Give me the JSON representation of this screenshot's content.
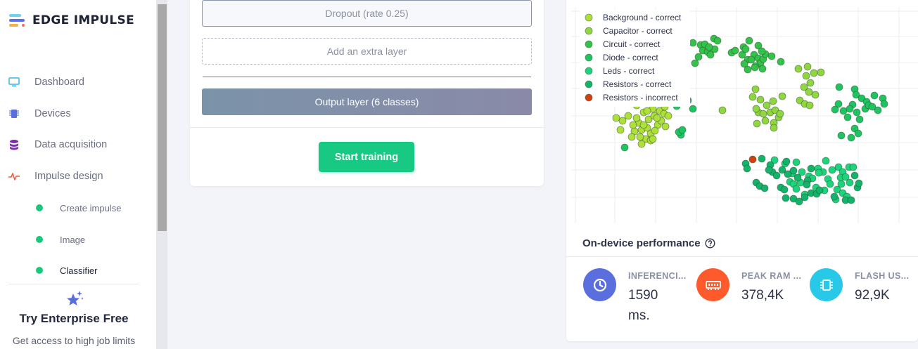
{
  "app": {
    "brand": "EDGE IMPULSE"
  },
  "sidebar": {
    "items": [
      {
        "label": "Dashboard",
        "icon": "monitor-icon"
      },
      {
        "label": "Devices",
        "icon": "chip-icon"
      },
      {
        "label": "Data acquisition",
        "icon": "database-icon"
      },
      {
        "label": "Impulse design",
        "icon": "pulse-icon"
      }
    ],
    "subitems": [
      {
        "label": "Create impulse"
      },
      {
        "label": "Image"
      },
      {
        "label": "Classifier",
        "active": true
      }
    ],
    "enterprise": {
      "title": "Try Enterprise Free",
      "subtitle": "Get access to high job limits"
    }
  },
  "layers": {
    "dropout": "Dropout (rate 0.25)",
    "add_extra": "Add an extra layer",
    "output": "Output layer (6 classes)"
  },
  "training": {
    "start_label": "Start training"
  },
  "chart_data": {
    "type": "scatter",
    "legend_position": "top-left",
    "grid": true,
    "series": [
      {
        "name": "Background - correct",
        "color": "#aee03a",
        "points": [
          [
            915,
            160
          ],
          [
            922,
            170
          ],
          [
            930,
            165
          ],
          [
            908,
            175
          ],
          [
            935,
            178
          ],
          [
            912,
            185
          ],
          [
            925,
            190
          ],
          [
            940,
            172
          ],
          [
            918,
            198
          ],
          [
            905,
            168
          ],
          [
            928,
            155
          ],
          [
            938,
            158
          ],
          [
            944,
            162
          ],
          [
            902,
            187
          ],
          [
            920,
            182
          ],
          [
            931,
            186
          ],
          [
            946,
            180
          ],
          [
            910,
            195
          ],
          [
            925,
            200
          ],
          [
            915,
            178
          ],
          [
            934,
            168
          ],
          [
            900,
            178
          ],
          [
            885,
            172
          ],
          [
            882,
            185
          ],
          [
            876,
            168
          ],
          [
            893,
            165
          ],
          [
            905,
            150
          ],
          [
            914,
            142
          ],
          [
            925,
            140
          ],
          [
            935,
            147
          ],
          [
            945,
            152
          ],
          [
            950,
            165
          ],
          [
            920,
            158
          ],
          [
            898,
            195
          ],
          [
            912,
            205
          ],
          [
            928,
            198
          ]
        ]
      },
      {
        "name": "Capacitor - correct",
        "color": "#8fd63f",
        "points": [
          [
            1081,
            142
          ],
          [
            1090,
            150
          ],
          [
            1078,
            160
          ],
          [
            1095,
            160
          ],
          [
            1102,
            157
          ],
          [
            1088,
            172
          ],
          [
            1100,
            175
          ],
          [
            1075,
            155
          ],
          [
            1107,
            167
          ],
          [
            1085,
            162
          ],
          [
            1070,
            138
          ],
          [
            1112,
            137
          ],
          [
            1099,
            144
          ],
          [
            1076,
            176
          ],
          [
            1100,
            182
          ],
          [
            1074,
            127
          ],
          [
            1135,
            98
          ],
          [
            1148,
            95
          ],
          [
            1157,
            104
          ],
          [
            1167,
            103
          ],
          [
            1146,
            108
          ],
          [
            1152,
            118
          ],
          [
            1143,
            124
          ],
          [
            1150,
            131
          ],
          [
            1159,
            135
          ],
          [
            1137,
            143
          ],
          [
            1144,
            148
          ],
          [
            1151,
            150
          ],
          [
            1027,
            157
          ],
          [
            1109,
            162
          ]
        ]
      },
      {
        "name": "Circuit - correct",
        "color": "#33c24a",
        "points": [
          [
            985,
            61
          ],
          [
            996,
            64
          ],
          [
            999,
            72
          ],
          [
            1006,
            74
          ],
          [
            1016,
            70
          ],
          [
            1002,
            63
          ],
          [
            1015,
            55
          ],
          [
            1010,
            78
          ],
          [
            1008,
            67
          ],
          [
            993,
            81
          ],
          [
            988,
            90
          ],
          [
            1020,
            58
          ],
          [
            1040,
            75
          ],
          [
            1045,
            72
          ],
          [
            1055,
            78
          ],
          [
            1063,
            85
          ],
          [
            1058,
            91
          ],
          [
            1063,
            99
          ],
          [
            1072,
            78
          ],
          [
            1078,
            83
          ],
          [
            1081,
            90
          ],
          [
            1085,
            84
          ],
          [
            1088,
            77
          ],
          [
            1074,
            94
          ],
          [
            1068,
            85
          ],
          [
            1084,
            98
          ],
          [
            1097,
            80
          ],
          [
            1110,
            88
          ],
          [
            1073,
            96
          ],
          [
            1057,
            67
          ],
          [
            1060,
            70
          ],
          [
            1078,
            65
          ],
          [
            1065,
            58
          ],
          [
            1083,
            73
          ]
        ]
      },
      {
        "name": "Diode - correct",
        "color": "#1fc462",
        "points": [
          [
            970,
            138
          ],
          [
            978,
            143
          ],
          [
            985,
            155
          ],
          [
            962,
            151
          ],
          [
            968,
            192
          ],
          [
            965,
            188
          ],
          [
            970,
            185
          ],
          [
            888,
            210
          ],
          [
            1193,
            124
          ],
          [
            1199,
            158
          ],
          [
            1215,
            127
          ],
          [
            1217,
            135
          ],
          [
            1225,
            140
          ],
          [
            1212,
            149
          ],
          [
            1208,
            155
          ],
          [
            1218,
            160
          ],
          [
            1230,
            155
          ],
          [
            1232,
            145
          ],
          [
            1235,
            150
          ],
          [
            1243,
            136
          ],
          [
            1255,
            140
          ],
          [
            1257,
            148
          ],
          [
            1248,
            157
          ],
          [
            1240,
            152
          ],
          [
            1222,
            170
          ],
          [
            1215,
            183
          ],
          [
            1220,
            190
          ],
          [
            1210,
            196
          ],
          [
            1192,
            148
          ],
          [
            1187,
            156
          ],
          [
            1205,
            167
          ],
          [
            1196,
            193
          ]
        ]
      },
      {
        "name": "Leds - correct",
        "color": "#1bd47c",
        "points": [
          [
            1101,
            228
          ],
          [
            1116,
            233
          ],
          [
            1132,
            231
          ],
          [
            1140,
            245
          ],
          [
            1150,
            251
          ],
          [
            1155,
            254
          ],
          [
            1163,
            240
          ],
          [
            1170,
            245
          ],
          [
            1177,
            255
          ],
          [
            1183,
            242
          ],
          [
            1192,
            238
          ],
          [
            1198,
            245
          ],
          [
            1207,
            238
          ],
          [
            1213,
            238
          ],
          [
            1195,
            253
          ],
          [
            1202,
            252
          ],
          [
            1208,
            260
          ],
          [
            1196,
            262
          ],
          [
            1174,
            229
          ],
          [
            1164,
            246
          ],
          [
            1126,
            247
          ],
          [
            1123,
            259
          ],
          [
            1128,
            262
          ],
          [
            1138,
            260
          ],
          [
            1132,
            269
          ],
          [
            1144,
            277
          ],
          [
            1160,
            267
          ],
          [
            1172,
            271
          ],
          [
            1180,
            262
          ],
          [
            1190,
            270
          ],
          [
            1198,
            275
          ],
          [
            1188,
            284
          ],
          [
            1204,
            280
          ]
        ]
      },
      {
        "name": "Resistors - correct",
        "color": "#14b36b",
        "points": [
          [
            1060,
            233
          ],
          [
            1062,
            240
          ],
          [
            1075,
            260
          ],
          [
            1080,
            265
          ],
          [
            1087,
            268
          ],
          [
            1095,
            235
          ],
          [
            1098,
            245
          ],
          [
            1104,
            250
          ],
          [
            1112,
            242
          ],
          [
            1118,
            230
          ],
          [
            1120,
            248
          ],
          [
            1128,
            243
          ],
          [
            1134,
            253
          ],
          [
            1148,
            257
          ],
          [
            1110,
            267
          ],
          [
            1115,
            270
          ],
          [
            1117,
            282
          ],
          [
            1128,
            283
          ],
          [
            1136,
            287
          ],
          [
            1144,
            281
          ],
          [
            1153,
            275
          ],
          [
            1161,
            276
          ],
          [
            1165,
            271
          ],
          [
            1186,
            280
          ],
          [
            1202,
            285
          ],
          [
            1210,
            285
          ],
          [
            1219,
            267
          ],
          [
            1221,
            261
          ],
          [
            1215,
            250
          ],
          [
            1083,
            226
          ],
          [
            1093,
            242
          ],
          [
            1147,
            263
          ],
          [
            1153,
            240
          ]
        ]
      },
      {
        "name": "Resistors - incorrect",
        "color": "#d1410f",
        "points": [
          [
            1070,
            227
          ]
        ]
      }
    ]
  },
  "performance": {
    "title": "On-device performance",
    "metrics": [
      {
        "label": "INFERENCI...",
        "value_line1": "1590",
        "value_line2": "ms.",
        "color": "#5a6fdd",
        "icon": "clock-icon"
      },
      {
        "label": "PEAK RAM ...",
        "value": "378,4K",
        "color": "#ff5a2c",
        "icon": "ram-icon"
      },
      {
        "label": "FLASH US...",
        "value": "92,9K",
        "color": "#27c8e8",
        "icon": "flash-chip-icon"
      }
    ]
  }
}
